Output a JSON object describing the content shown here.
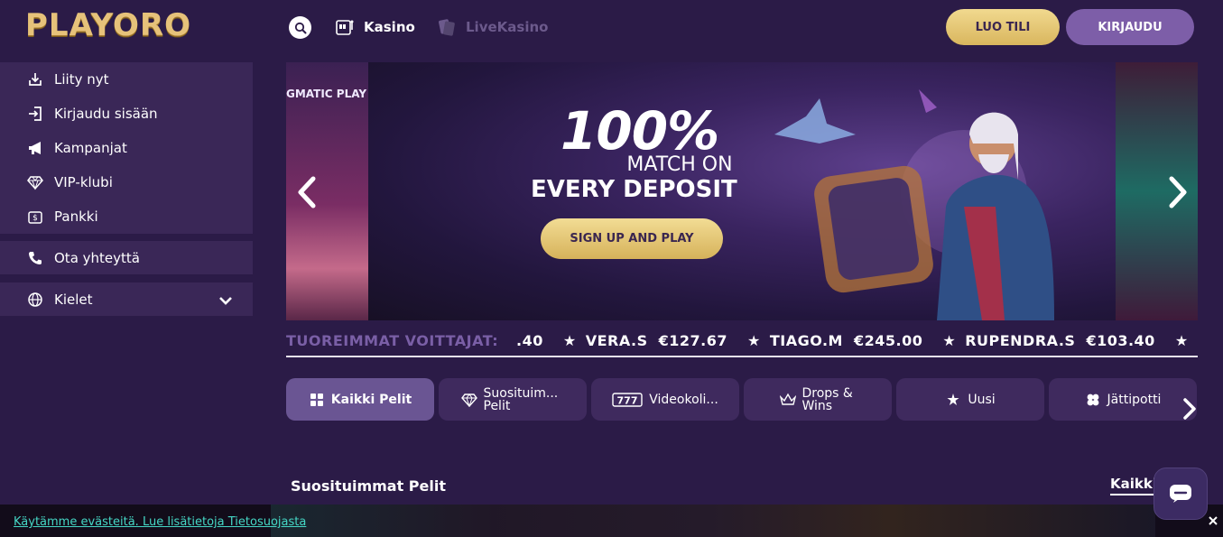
{
  "brand": {
    "logo_text": "PLAYORO"
  },
  "header": {
    "nav": [
      {
        "label": "Kasino",
        "icon": "slot-machine-icon"
      },
      {
        "label": "LiveKasino",
        "icon": "cards-icon"
      }
    ],
    "register_label": "LUO TILI",
    "login_label": "KIRJAUDU"
  },
  "sidebar": {
    "items": [
      {
        "label": "Liity nyt",
        "icon": "download-icon"
      },
      {
        "label": "Kirjaudu sisään",
        "icon": "login-icon"
      },
      {
        "label": "Kampanjat",
        "icon": "megaphone-icon"
      },
      {
        "label": "VIP-klubi",
        "icon": "diamond-icon"
      },
      {
        "label": "Pankki",
        "icon": "bank-icon"
      }
    ],
    "contact": {
      "label": "Ota yhteyttä",
      "icon": "phone-icon"
    },
    "language": {
      "label": "Kielet",
      "icon": "globe-icon"
    }
  },
  "banner": {
    "provider": "GMATIC PLAY",
    "headline": "100%",
    "line2": "MATCH ON",
    "line3": "EVERY DEPOSIT",
    "cta": "SIGN UP AND PLAY"
  },
  "ticker": {
    "title": "TUOREIMMAT VOITTAJAT:",
    "leading_fragment": ".40",
    "entries": [
      {
        "name": "VERA.S",
        "amount": "€127.67"
      },
      {
        "name": "TIAGO.M",
        "amount": "€245.00"
      },
      {
        "name": "RUPENDRA.S",
        "amount": "€103.40"
      }
    ]
  },
  "categories": [
    {
      "label": "Kaikki Pelit",
      "icon": "grid-icon",
      "active": true
    },
    {
      "label": "Suosituim... Pelit",
      "icon": "diamond-icon",
      "active": false
    },
    {
      "label": "Videokoli...",
      "icon": "777-icon",
      "active": false
    },
    {
      "label": "Drops & Wins",
      "icon": "crown-icon",
      "active": false
    },
    {
      "label": "Uusi",
      "icon": "stars-icon",
      "active": false
    },
    {
      "label": "Jättipotti",
      "icon": "clover-icon",
      "active": false
    }
  ],
  "section": {
    "title": "Suosituimmat Pelit",
    "see_all": "Kaikki"
  },
  "cookie": {
    "text": "Käytämme evästeitä. Lue lisätietoja Tietosuojasta"
  },
  "colors": {
    "background": "#2b1b47",
    "sidebar": "#3a2757",
    "gold": "#e6c27a",
    "login_button": "#7d5ea8",
    "cookie_link": "#45d7c5"
  }
}
